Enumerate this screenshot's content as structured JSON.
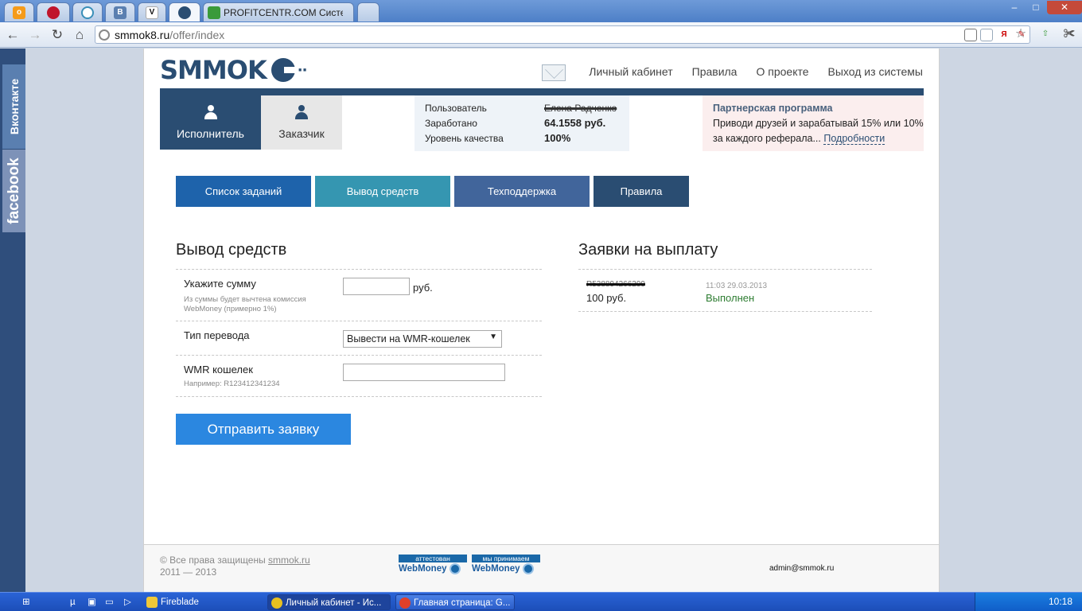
{
  "browser": {
    "tabs": [
      {
        "icon": "odnoklassniki-icon",
        "label": "",
        "color": "#f59b1a"
      },
      {
        "icon": "round-red-icon",
        "label": "",
        "color": "#c0152c"
      },
      {
        "icon": "target-icon",
        "label": "",
        "color": "#3a8fb8"
      },
      {
        "icon": "vk-icon",
        "label": "",
        "color": "#5a7fb0"
      },
      {
        "icon": "v-icon",
        "label": "",
        "color": "#e6c84a"
      },
      {
        "icon": "smmok-icon",
        "label": "",
        "color": "#2a4d72"
      },
      {
        "icon": "chart-icon",
        "label": "PROFITCENTR.COM Система",
        "color": "#3a9a3a"
      }
    ],
    "url": {
      "host": "smmok8.ru",
      "path": "/offer/index"
    },
    "window_controls": {
      "minimize": "–",
      "maximize": "□",
      "close": "✕"
    }
  },
  "social": {
    "vk_label": "Вконтакте",
    "fb_label": "facebook"
  },
  "site": {
    "logo": "SMMOK",
    "nav": [
      "Личный кабинет",
      "Правила",
      "О проекте",
      "Выход из системы"
    ],
    "roles": {
      "executor": "Исполнитель",
      "customer": "Заказчик"
    },
    "stats": {
      "user_label": "Пользователь",
      "user_value": "Елена Радченко",
      "earned_label": "Заработано",
      "earned_value": "64.1558 руб.",
      "quality_label": "Уровень качества",
      "quality_value": "100%"
    },
    "partner": {
      "title": "Партнерская программа",
      "text": "Приводи друзей и зарабатывай 15% или 10% за каждого реферала...",
      "link": "Подробности"
    },
    "menu": [
      "Список заданий",
      "Вывод средств",
      "Техподдержка",
      "Правила"
    ],
    "withdraw": {
      "heading": "Вывод средств",
      "amount_label": "Укажите сумму",
      "amount_hint": "Из суммы будет вычтена комиссия WebMoney (примерно 1%)",
      "amount_value": "",
      "amount_unit": "руб.",
      "type_label": "Тип перевода",
      "type_value": "Вывести на WMR-кошелек",
      "wallet_label": "WMR кошелек",
      "wallet_hint": "Например: R123412341234",
      "wallet_value": "",
      "submit": "Отправить заявку"
    },
    "payouts": {
      "heading": "Заявки на выплату",
      "items": [
        {
          "wallet": "R538894266299",
          "sum": "100 руб.",
          "date": "11:03 29.03.2013",
          "status": "Выполнен"
        }
      ]
    },
    "footer": {
      "rights": "© Все права защищены",
      "site_link": "smmok.ru",
      "years": "2011 — 2013",
      "badge1_top": "аттестован",
      "badge1_bottom": "WebMoney",
      "badge2_top": "мы принимаем",
      "badge2_bottom": "WebMoney",
      "email": "admin@smmok.ru"
    }
  },
  "taskbar": {
    "items": [
      "Fireblade",
      "Личный кабинет - Ис...",
      "Главная страница: G..."
    ],
    "clock": "10:18"
  }
}
